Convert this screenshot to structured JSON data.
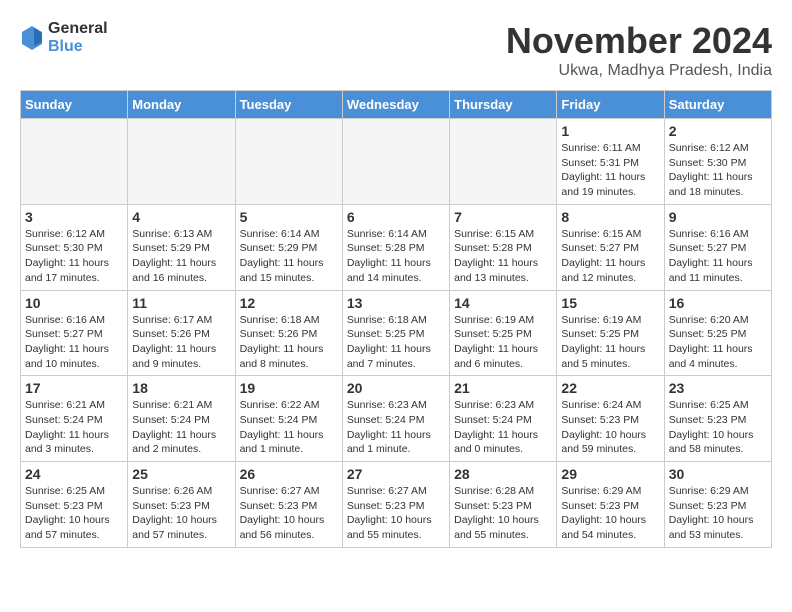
{
  "logo": {
    "general": "General",
    "blue": "Blue"
  },
  "header": {
    "month": "November 2024",
    "location": "Ukwa, Madhya Pradesh, India"
  },
  "weekdays": [
    "Sunday",
    "Monday",
    "Tuesday",
    "Wednesday",
    "Thursday",
    "Friday",
    "Saturday"
  ],
  "weeks": [
    [
      {
        "day": "",
        "info": ""
      },
      {
        "day": "",
        "info": ""
      },
      {
        "day": "",
        "info": ""
      },
      {
        "day": "",
        "info": ""
      },
      {
        "day": "",
        "info": ""
      },
      {
        "day": "1",
        "info": "Sunrise: 6:11 AM\nSunset: 5:31 PM\nDaylight: 11 hours and 19 minutes."
      },
      {
        "day": "2",
        "info": "Sunrise: 6:12 AM\nSunset: 5:30 PM\nDaylight: 11 hours and 18 minutes."
      }
    ],
    [
      {
        "day": "3",
        "info": "Sunrise: 6:12 AM\nSunset: 5:30 PM\nDaylight: 11 hours and 17 minutes."
      },
      {
        "day": "4",
        "info": "Sunrise: 6:13 AM\nSunset: 5:29 PM\nDaylight: 11 hours and 16 minutes."
      },
      {
        "day": "5",
        "info": "Sunrise: 6:14 AM\nSunset: 5:29 PM\nDaylight: 11 hours and 15 minutes."
      },
      {
        "day": "6",
        "info": "Sunrise: 6:14 AM\nSunset: 5:28 PM\nDaylight: 11 hours and 14 minutes."
      },
      {
        "day": "7",
        "info": "Sunrise: 6:15 AM\nSunset: 5:28 PM\nDaylight: 11 hours and 13 minutes."
      },
      {
        "day": "8",
        "info": "Sunrise: 6:15 AM\nSunset: 5:27 PM\nDaylight: 11 hours and 12 minutes."
      },
      {
        "day": "9",
        "info": "Sunrise: 6:16 AM\nSunset: 5:27 PM\nDaylight: 11 hours and 11 minutes."
      }
    ],
    [
      {
        "day": "10",
        "info": "Sunrise: 6:16 AM\nSunset: 5:27 PM\nDaylight: 11 hours and 10 minutes."
      },
      {
        "day": "11",
        "info": "Sunrise: 6:17 AM\nSunset: 5:26 PM\nDaylight: 11 hours and 9 minutes."
      },
      {
        "day": "12",
        "info": "Sunrise: 6:18 AM\nSunset: 5:26 PM\nDaylight: 11 hours and 8 minutes."
      },
      {
        "day": "13",
        "info": "Sunrise: 6:18 AM\nSunset: 5:25 PM\nDaylight: 11 hours and 7 minutes."
      },
      {
        "day": "14",
        "info": "Sunrise: 6:19 AM\nSunset: 5:25 PM\nDaylight: 11 hours and 6 minutes."
      },
      {
        "day": "15",
        "info": "Sunrise: 6:19 AM\nSunset: 5:25 PM\nDaylight: 11 hours and 5 minutes."
      },
      {
        "day": "16",
        "info": "Sunrise: 6:20 AM\nSunset: 5:25 PM\nDaylight: 11 hours and 4 minutes."
      }
    ],
    [
      {
        "day": "17",
        "info": "Sunrise: 6:21 AM\nSunset: 5:24 PM\nDaylight: 11 hours and 3 minutes."
      },
      {
        "day": "18",
        "info": "Sunrise: 6:21 AM\nSunset: 5:24 PM\nDaylight: 11 hours and 2 minutes."
      },
      {
        "day": "19",
        "info": "Sunrise: 6:22 AM\nSunset: 5:24 PM\nDaylight: 11 hours and 1 minute."
      },
      {
        "day": "20",
        "info": "Sunrise: 6:23 AM\nSunset: 5:24 PM\nDaylight: 11 hours and 1 minute."
      },
      {
        "day": "21",
        "info": "Sunrise: 6:23 AM\nSunset: 5:24 PM\nDaylight: 11 hours and 0 minutes."
      },
      {
        "day": "22",
        "info": "Sunrise: 6:24 AM\nSunset: 5:23 PM\nDaylight: 10 hours and 59 minutes."
      },
      {
        "day": "23",
        "info": "Sunrise: 6:25 AM\nSunset: 5:23 PM\nDaylight: 10 hours and 58 minutes."
      }
    ],
    [
      {
        "day": "24",
        "info": "Sunrise: 6:25 AM\nSunset: 5:23 PM\nDaylight: 10 hours and 57 minutes."
      },
      {
        "day": "25",
        "info": "Sunrise: 6:26 AM\nSunset: 5:23 PM\nDaylight: 10 hours and 57 minutes."
      },
      {
        "day": "26",
        "info": "Sunrise: 6:27 AM\nSunset: 5:23 PM\nDaylight: 10 hours and 56 minutes."
      },
      {
        "day": "27",
        "info": "Sunrise: 6:27 AM\nSunset: 5:23 PM\nDaylight: 10 hours and 55 minutes."
      },
      {
        "day": "28",
        "info": "Sunrise: 6:28 AM\nSunset: 5:23 PM\nDaylight: 10 hours and 55 minutes."
      },
      {
        "day": "29",
        "info": "Sunrise: 6:29 AM\nSunset: 5:23 PM\nDaylight: 10 hours and 54 minutes."
      },
      {
        "day": "30",
        "info": "Sunrise: 6:29 AM\nSunset: 5:23 PM\nDaylight: 10 hours and 53 minutes."
      }
    ]
  ]
}
